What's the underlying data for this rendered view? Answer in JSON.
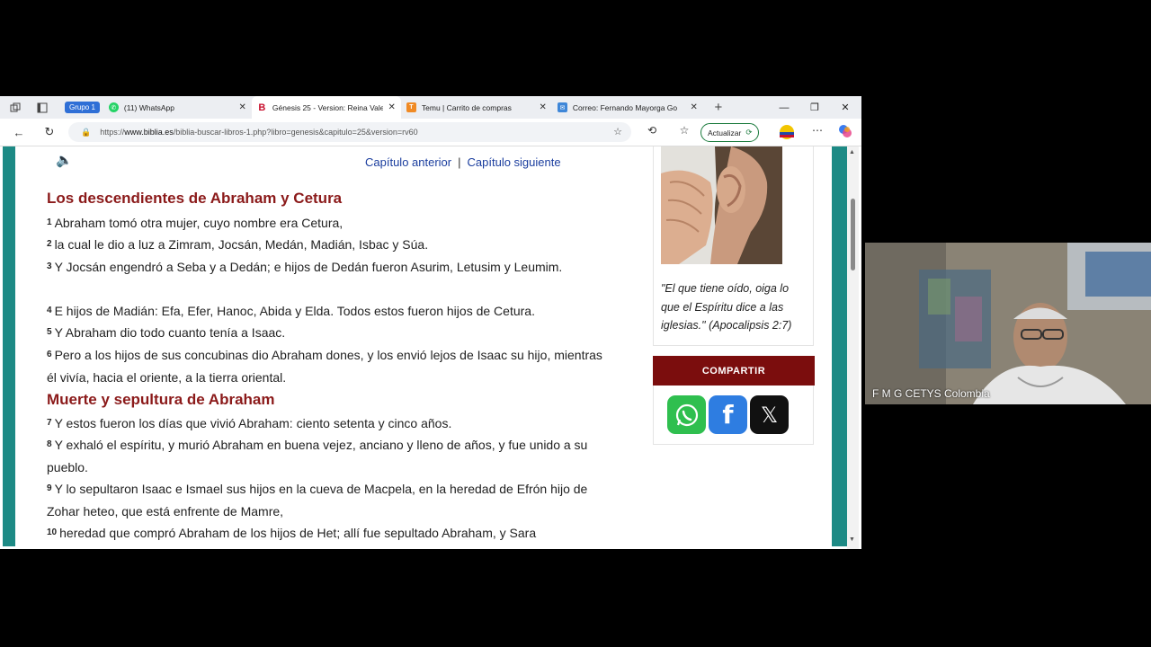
{
  "browser": {
    "group_chip": "Grupo 1",
    "tabs": [
      {
        "title": "(11) WhatsApp",
        "favicon": "whatsapp-icon",
        "color": "#25d366",
        "active": false
      },
      {
        "title": "Génesis 25 - Version: Reina Vale",
        "favicon": "biblia-b-icon",
        "color": "#c8102e",
        "active": true
      },
      {
        "title": "Temu | Carrito de compras",
        "favicon": "temu-icon",
        "color": "#f08a24",
        "active": false
      },
      {
        "title": "Correo: Fernando Mayorga Go",
        "favicon": "mail-icon",
        "color": "#3f87d8",
        "active": false
      }
    ],
    "url_prefix": "https://",
    "url_domain": "www.biblia.es",
    "url_path": "/biblia-buscar-libros-1.php?libro=genesis&capitulo=25&version=rv60",
    "update_label": "Actualizar"
  },
  "page": {
    "prev_chapter": "Capítulo anterior",
    "separator": "|",
    "next_chapter": "Capítulo siguiente",
    "heading1": "Los descendientes de Abraham y Cetura",
    "heading2": "Muerte y sepultura de Abraham",
    "verses": [
      {
        "n": "1",
        "text": "Abraham tomó otra mujer, cuyo nombre era Cetura,"
      },
      {
        "n": "2",
        "text": "la cual le dio a luz a Zimram, Jocsán, Medán, Madián, Isbac y Súa."
      },
      {
        "n": "3",
        "text": "Y Jocsán engendró a Seba y a Dedán; e hijos de Dedán fueron Asurim, Letusim y Leumim."
      },
      {
        "n": "4",
        "text": "E hijos de Madián: Efa, Efer, Hanoc, Abida y Elda. Todos estos fueron hijos de Cetura."
      },
      {
        "n": "5",
        "text": "Y Abraham dio todo cuanto tenía a Isaac."
      },
      {
        "n": "6",
        "text": "Pero a los hijos de sus concubinas dio Abraham dones, y los envió lejos de Isaac su hijo, mientras él vivía, hacia el oriente, a la tierra oriental."
      },
      {
        "n": "7",
        "text": "Y estos fueron los días que vivió Abraham: ciento setenta y cinco años."
      },
      {
        "n": "8",
        "text": "Y exhaló el espíritu, y murió Abraham en buena vejez, anciano y lleno de años, y fue unido a su pueblo."
      },
      {
        "n": "9",
        "text": "Y lo sepultaron Isaac e Ismael sus hijos en la cueva de Macpela, en la heredad de Efrón hijo de Zohar heteo, que está enfrente de Mamre,"
      },
      {
        "n": "10",
        "text": "heredad que compró Abraham de los hijos de Het; allí fue sepultado Abraham, y Sara"
      }
    ],
    "quote": "\"El que tiene oído, oiga lo que el Espíritu dice a las iglesias.\" (Apocalipsis 2:7)",
    "share_label": "COMPARTIR"
  },
  "video": {
    "participant": "F M G CETYS Colombia"
  },
  "colors": {
    "heading": "#8b1a1a",
    "teal": "#1d8a85",
    "share": "#7b0d0d",
    "link": "#1a3d9e"
  }
}
